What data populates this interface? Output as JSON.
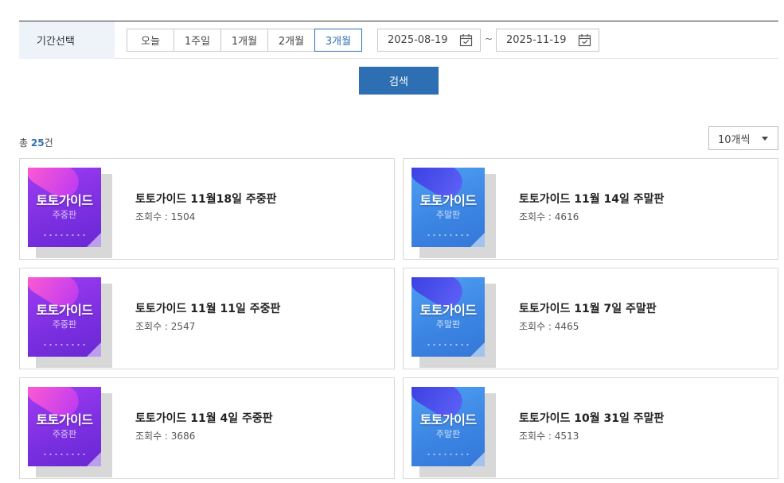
{
  "filter": {
    "label": "기간선택",
    "periods": [
      "오늘",
      "1주일",
      "1개월",
      "2개월",
      "3개월"
    ],
    "active_period": "3개월",
    "start_date": "2025-08-19",
    "end_date": "2025-11-19",
    "separator": "~"
  },
  "search_button": "검색",
  "list_header": {
    "total_prefix": "총 ",
    "total_count": "25",
    "total_suffix": "건",
    "per_page": "10개씩"
  },
  "items": [
    {
      "title": "토토가이드 11월18일 주중판",
      "views_label": "조회수 : ",
      "views": "1504",
      "thumb_title": "토토가이드",
      "thumb_sub": "주중판",
      "theme": "purple"
    },
    {
      "title": "토토가이드 11월 14일 주말판",
      "views_label": "조회수 : ",
      "views": "4616",
      "thumb_title": "토토가이드",
      "thumb_sub": "주말판",
      "theme": "blue"
    },
    {
      "title": "토토가이드 11월 11일 주중판",
      "views_label": "조회수 : ",
      "views": "2547",
      "thumb_title": "토토가이드",
      "thumb_sub": "주중판",
      "theme": "purple"
    },
    {
      "title": "토토가이드 11월 7일 주말판",
      "views_label": "조회수 : ",
      "views": "4465",
      "thumb_title": "토토가이드",
      "thumb_sub": "주말판",
      "theme": "blue"
    },
    {
      "title": "토토가이드 11월 4일 주중판",
      "views_label": "조회수 : ",
      "views": "3686",
      "thumb_title": "토토가이드",
      "thumb_sub": "주중판",
      "theme": "purple"
    },
    {
      "title": "토토가이드 10월 31일 주말판",
      "views_label": "조회수 : ",
      "views": "4513",
      "thumb_title": "토토가이드",
      "thumb_sub": "주말판",
      "theme": "blue"
    }
  ],
  "colors": {
    "accent": "#2d6fb2",
    "purple_thumb": "#7a2fe0",
    "blue_thumb": "#3b84e2"
  },
  "icons": {
    "date_picker": "calendar-icon",
    "per_page_toggle": "caret-down-icon"
  }
}
